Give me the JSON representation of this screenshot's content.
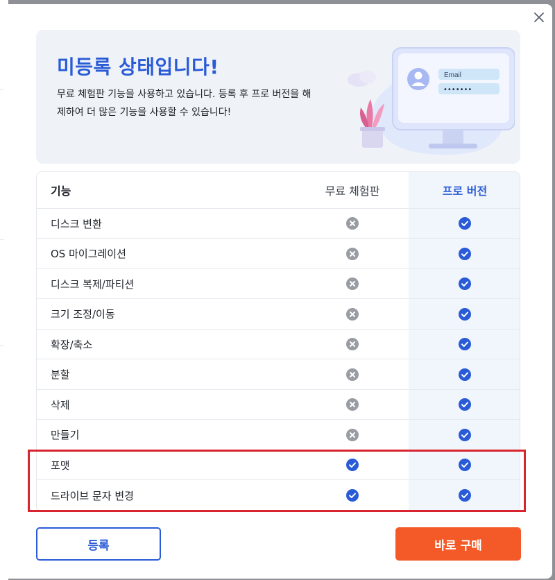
{
  "dialog": {
    "banner": {
      "title": "미등록 상태입니다!",
      "description": "무료 체험판 기능을 사용하고 있습니다. 등록 후 프로 버전을 해제하여 더 많은 기능을 사용할 수 있습니다!",
      "illustration": {
        "email_label": "Email",
        "password_mask": "•••••••"
      }
    },
    "table": {
      "headers": {
        "feature": "기능",
        "free": "무료 체험판",
        "pro": "프로 버전"
      },
      "rows": [
        {
          "feature": "디스크 변환",
          "free": "unavailable",
          "pro": "available"
        },
        {
          "feature": "OS 마이그레이션",
          "free": "unavailable",
          "pro": "available"
        },
        {
          "feature": "디스크 복제/파티션",
          "free": "unavailable",
          "pro": "available"
        },
        {
          "feature": "크기 조정/이동",
          "free": "unavailable",
          "pro": "available"
        },
        {
          "feature": "확장/축소",
          "free": "unavailable",
          "pro": "available"
        },
        {
          "feature": "분할",
          "free": "unavailable",
          "pro": "available"
        },
        {
          "feature": "삭제",
          "free": "unavailable",
          "pro": "available"
        },
        {
          "feature": "만들기",
          "free": "unavailable",
          "pro": "available"
        },
        {
          "feature": "포맷",
          "free": "available",
          "pro": "available"
        },
        {
          "feature": "드라이브 문자 변경",
          "free": "available",
          "pro": "available"
        }
      ]
    },
    "buttons": {
      "register": "등록",
      "buy_now": "바로 구매"
    },
    "icons": {
      "close": "close-icon",
      "available": "check-circle-icon",
      "unavailable": "x-circle-icon"
    },
    "colors": {
      "accent": "#2a5bd7",
      "buy": "#f35a28",
      "highlight": "#d8242e",
      "unavailable": "#9a9ca3"
    }
  }
}
